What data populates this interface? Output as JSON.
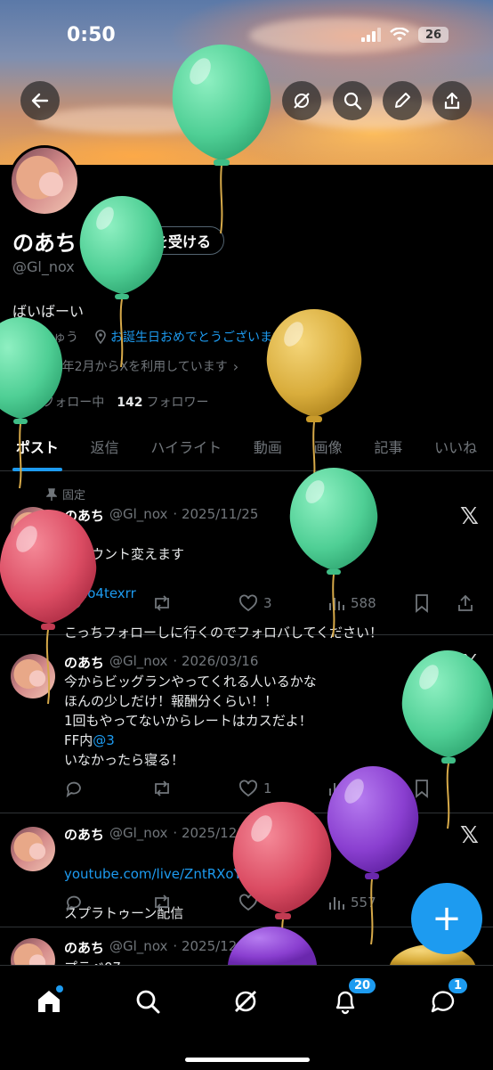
{
  "status_bar": {
    "time": "0:50",
    "battery": "26"
  },
  "profile": {
    "name": "のあち",
    "verify_button": "認証を受ける",
    "handle": "@Gl_nox",
    "bio": "ばいばーい",
    "location": "ちきゅう",
    "website": "お誕生日おめでとうございます。",
    "joined": "2023年2月からXを利用しています",
    "following_count": "193",
    "following_label": "フォロー中",
    "followers_count": "142",
    "followers_label": "フォロワー"
  },
  "tabs": [
    "ポスト",
    "返信",
    "ハイライト",
    "動画",
    "画像",
    "記事",
    "いいね"
  ],
  "posts": [
    {
      "pinned_label": "固定",
      "name": "のあち",
      "handle": "@Gl_nox",
      "date": "· 2025/11/25",
      "line1": "アカウント変えます",
      "link": "@No4texrr",
      "line3": "こっちフォローしに行くのでフォロバしてください！",
      "likes": "3",
      "views": "588"
    },
    {
      "name": "のあち",
      "handle": "@Gl_nox",
      "date": "· 2026/03/16",
      "text_a": "今からビッグランやってくれる人いるかな\nほんの少しだけ！報酬分くらい！！\n1回もやってないからレートはカスだよ！\nFF内",
      "mention": "@3",
      "text_b": "いなかったら寝る！",
      "likes": "1",
      "views": "125"
    },
    {
      "name": "のあち",
      "handle": "@Gl_nox",
      "date": "· 2025/12/29",
      "link": "youtube.com/live/ZntRXoYNZ…",
      "text": "スプラトゥーン配信",
      "views": "557"
    },
    {
      "name": "のあち",
      "handle": "@Gl_nox",
      "date": "· 2025/12/2",
      "text": "プラベ07"
    }
  ],
  "nav": {
    "notifications_badge": "20",
    "messages_badge": "1"
  },
  "colors": {
    "accent": "#1d9bf0",
    "balloon_green": "#5fd6a0",
    "balloon_yellow": "#e2b84a",
    "balloon_red": "#e0556a",
    "balloon_purple": "#8a3fd0"
  }
}
